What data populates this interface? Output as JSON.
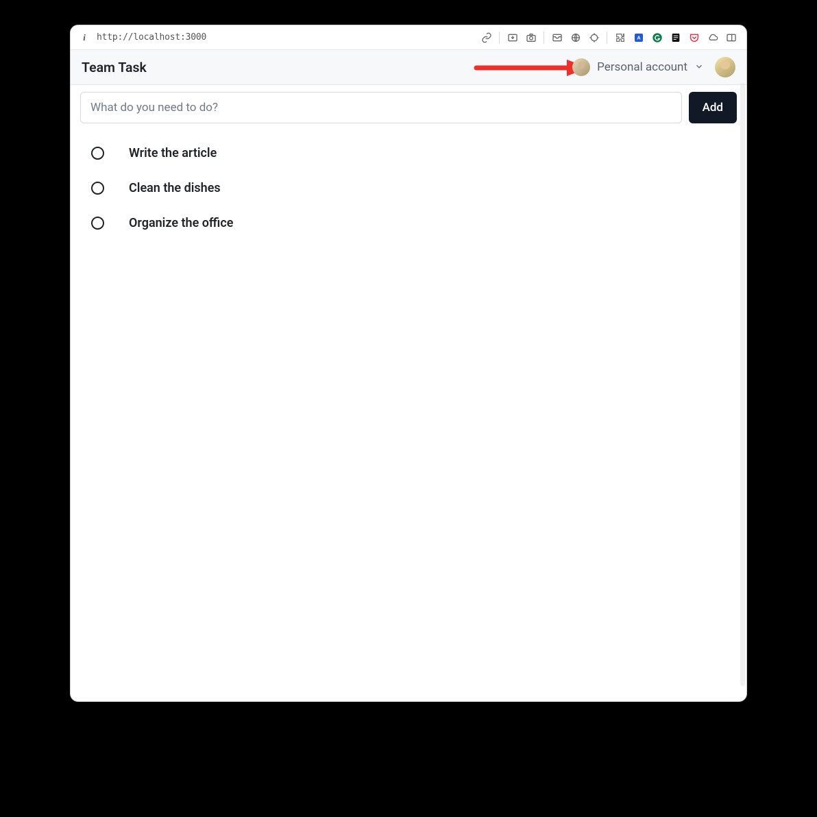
{
  "browser": {
    "url": "http://localhost:3000",
    "toolbar_icons": [
      "link-icon",
      "download-tray-icon",
      "camera-icon",
      "inbox-icon",
      "globe-icon",
      "crosshair-icon",
      "puzzle-icon",
      "translate-icon",
      "grammarly-icon",
      "notes-icon",
      "pocket-icon",
      "cloud-icon",
      "sidebar-panel-icon"
    ]
  },
  "header": {
    "app_title": "Team Task",
    "account_label": "Personal account"
  },
  "input": {
    "placeholder": "What do you need to do?",
    "add_button": "Add"
  },
  "tasks": [
    {
      "label": "Write the article",
      "completed": false
    },
    {
      "label": "Clean the dishes",
      "completed": false
    },
    {
      "label": "Organize the office",
      "completed": false
    }
  ],
  "annotation": {
    "type": "arrow",
    "color": "#ef2f2a",
    "points_to": "account-switcher"
  }
}
